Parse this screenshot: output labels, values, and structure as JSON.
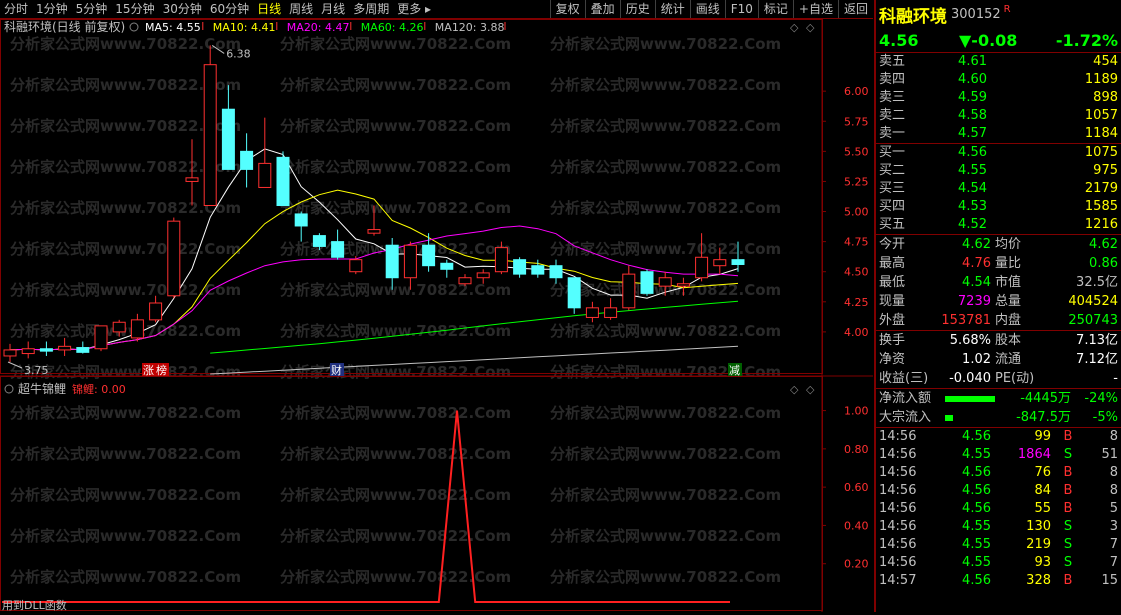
{
  "toolbar": {
    "periods": [
      "分时",
      "1分钟",
      "5分钟",
      "15分钟",
      "30分钟",
      "60分钟",
      "日线",
      "周线",
      "月线",
      "多周期",
      "更多"
    ],
    "active_index": 6,
    "right_buttons": [
      "复权",
      "叠加",
      "历史",
      "统计",
      "画线",
      "F10",
      "标记",
      "+自选",
      "返回"
    ]
  },
  "chart": {
    "title": "科融环境(日线 前复权)",
    "ma": [
      {
        "label": "MA5: 4.55",
        "color": "#ffffff"
      },
      {
        "label": "MA10: 4.41",
        "color": "#ffff00"
      },
      {
        "label": "MA20: 4.47",
        "color": "#ff00ff"
      },
      {
        "label": "MA60: 4.26",
        "color": "#00ff00"
      },
      {
        "label": "MA120: 3.88",
        "color": "#c0c0c0"
      }
    ],
    "high_label": "6.38",
    "low_label": "3.75",
    "price_ticks": [
      "6.00",
      "5.75",
      "5.50",
      "5.25",
      "5.00",
      "4.75",
      "4.50",
      "4.25",
      "4.00"
    ],
    "markers": [
      {
        "text": "涨",
        "bg": "#c00000"
      },
      {
        "text": "榜",
        "bg": "#c00000"
      },
      {
        "text": "财",
        "bg": "#203080"
      },
      {
        "text": "减",
        "bg": "#006000"
      }
    ],
    "watermark": "分析家公式网www.70822.Com"
  },
  "indicator": {
    "name": "超牛锦鲤",
    "series_label": "锦鲤: 0.00",
    "ticks": [
      "1.00",
      "0.80",
      "0.60",
      "0.40",
      "0.20"
    ],
    "footer": "用到DLL函数"
  },
  "chart_data": [
    {
      "type": "candlestick",
      "title": "科融环境(日线 前复权)",
      "ylim": [
        3.7,
        6.45
      ],
      "candles": [
        {
          "o": 3.8,
          "h": 3.9,
          "l": 3.75,
          "c": 3.85
        },
        {
          "o": 3.82,
          "h": 3.92,
          "l": 3.78,
          "c": 3.86
        },
        {
          "o": 3.86,
          "h": 3.92,
          "l": 3.8,
          "c": 3.84
        },
        {
          "o": 3.85,
          "h": 3.95,
          "l": 3.8,
          "c": 3.88
        },
        {
          "o": 3.87,
          "h": 3.92,
          "l": 3.82,
          "c": 3.83
        },
        {
          "o": 3.86,
          "h": 4.05,
          "l": 3.84,
          "c": 4.05
        },
        {
          "o": 4.0,
          "h": 4.1,
          "l": 3.96,
          "c": 4.08
        },
        {
          "o": 3.95,
          "h": 4.15,
          "l": 3.92,
          "c": 4.1
        },
        {
          "o": 4.1,
          "h": 4.3,
          "l": 4.08,
          "c": 4.24
        },
        {
          "o": 4.3,
          "h": 4.95,
          "l": 4.28,
          "c": 4.92
        },
        {
          "o": 5.25,
          "h": 5.6,
          "l": 5.05,
          "c": 5.28
        },
        {
          "o": 5.05,
          "h": 6.38,
          "l": 5.05,
          "c": 6.22
        },
        {
          "o": 5.85,
          "h": 6.05,
          "l": 5.4,
          "c": 5.35
        },
        {
          "o": 5.5,
          "h": 5.65,
          "l": 5.2,
          "c": 5.35
        },
        {
          "o": 5.2,
          "h": 5.78,
          "l": 5.2,
          "c": 5.4
        },
        {
          "o": 5.45,
          "h": 5.5,
          "l": 5.05,
          "c": 5.05
        },
        {
          "o": 4.98,
          "h": 5.0,
          "l": 4.75,
          "c": 4.88
        },
        {
          "o": 4.8,
          "h": 4.82,
          "l": 4.68,
          "c": 4.71
        },
        {
          "o": 4.75,
          "h": 4.85,
          "l": 4.6,
          "c": 4.62
        },
        {
          "o": 4.5,
          "h": 4.63,
          "l": 4.48,
          "c": 4.6
        },
        {
          "o": 4.82,
          "h": 5.05,
          "l": 4.8,
          "c": 4.85
        },
        {
          "o": 4.72,
          "h": 4.78,
          "l": 4.35,
          "c": 4.45
        },
        {
          "o": 4.45,
          "h": 4.75,
          "l": 4.35,
          "c": 4.72
        },
        {
          "o": 4.72,
          "h": 4.82,
          "l": 4.5,
          "c": 4.55
        },
        {
          "o": 4.57,
          "h": 4.6,
          "l": 4.45,
          "c": 4.52
        },
        {
          "o": 4.4,
          "h": 4.48,
          "l": 4.38,
          "c": 4.45
        },
        {
          "o": 4.45,
          "h": 4.52,
          "l": 4.4,
          "c": 4.49
        },
        {
          "o": 4.5,
          "h": 4.75,
          "l": 4.48,
          "c": 4.7
        },
        {
          "o": 4.6,
          "h": 4.62,
          "l": 4.45,
          "c": 4.48
        },
        {
          "o": 4.55,
          "h": 4.6,
          "l": 4.45,
          "c": 4.48
        },
        {
          "o": 4.55,
          "h": 4.6,
          "l": 4.4,
          "c": 4.45
        },
        {
          "o": 4.45,
          "h": 4.45,
          "l": 4.15,
          "c": 4.2
        },
        {
          "o": 4.12,
          "h": 4.25,
          "l": 4.08,
          "c": 4.2
        },
        {
          "o": 4.12,
          "h": 4.28,
          "l": 4.1,
          "c": 4.2
        },
        {
          "o": 4.2,
          "h": 4.55,
          "l": 4.18,
          "c": 4.48
        },
        {
          "o": 4.5,
          "h": 4.52,
          "l": 4.3,
          "c": 4.32
        },
        {
          "o": 4.38,
          "h": 4.5,
          "l": 4.3,
          "c": 4.45
        },
        {
          "o": 4.38,
          "h": 4.45,
          "l": 4.3,
          "c": 4.4
        },
        {
          "o": 4.45,
          "h": 4.82,
          "l": 4.42,
          "c": 4.62
        },
        {
          "o": 4.55,
          "h": 4.7,
          "l": 4.48,
          "c": 4.6
        },
        {
          "o": 4.6,
          "h": 4.75,
          "l": 4.5,
          "c": 4.56
        }
      ]
    },
    {
      "type": "line",
      "title": "超牛锦鲤",
      "ylim": [
        0,
        1.05
      ],
      "series": [
        {
          "name": "锦鲤",
          "values": [
            0,
            0,
            0,
            0,
            0,
            0,
            0,
            0,
            0,
            0,
            0,
            0,
            0,
            0,
            0,
            0,
            0,
            0,
            0,
            0,
            0,
            0,
            0,
            0,
            0,
            1,
            0,
            0,
            0,
            0,
            0,
            0,
            0,
            0,
            0,
            0,
            0,
            0,
            0,
            0,
            0
          ]
        }
      ]
    }
  ],
  "quote": {
    "name": "科融环境",
    "code": "300152",
    "flag": "R",
    "price": "4.56",
    "change": "▼-0.08",
    "pct": "-1.72%",
    "asks": [
      {
        "label": "卖五",
        "price": "4.61",
        "vol": "454",
        "color": "#00ff00"
      },
      {
        "label": "卖四",
        "price": "4.60",
        "vol": "1189",
        "color": "#00ff00"
      },
      {
        "label": "卖三",
        "price": "4.59",
        "vol": "898",
        "color": "#00ff00"
      },
      {
        "label": "卖二",
        "price": "4.58",
        "vol": "1057",
        "color": "#00ff00"
      },
      {
        "label": "卖一",
        "price": "4.57",
        "vol": "1184",
        "color": "#00ff00"
      }
    ],
    "bids": [
      {
        "label": "买一",
        "price": "4.56",
        "vol": "1075",
        "color": "#00ff00"
      },
      {
        "label": "买二",
        "price": "4.55",
        "vol": "975",
        "color": "#00ff00"
      },
      {
        "label": "买三",
        "price": "4.54",
        "vol": "2179",
        "color": "#00ff00"
      },
      {
        "label": "买四",
        "price": "4.53",
        "vol": "1585",
        "color": "#00ff00"
      },
      {
        "label": "买五",
        "price": "4.52",
        "vol": "1216",
        "color": "#00ff00"
      }
    ],
    "stats": [
      {
        "l1": "今开",
        "v1": "4.62",
        "c1": "#00ff00",
        "l2": "均价",
        "v2": "4.62",
        "c2": "#00ff00"
      },
      {
        "l1": "最高",
        "v1": "4.76",
        "c1": "#ff3030",
        "l2": "量比",
        "v2": "0.86",
        "c2": "#00ff00"
      },
      {
        "l1": "最低",
        "v1": "4.54",
        "c1": "#00ff00",
        "l2": "市值",
        "v2": "32.5亿",
        "c2": "#c0c0c0"
      },
      {
        "l1": "现量",
        "v1": "7239",
        "c1": "#ff00ff",
        "l2": "总量",
        "v2": "404524",
        "c2": "#ffff00"
      },
      {
        "l1": "外盘",
        "v1": "153781",
        "c1": "#ff3030",
        "l2": "内盘",
        "v2": "250743",
        "c2": "#00ff00"
      }
    ],
    "fund": [
      {
        "l1": "换手",
        "v1": "5.68%",
        "l2": "股本",
        "v2": "7.13亿"
      },
      {
        "l1": "净资",
        "v1": "1.02",
        "l2": "流通",
        "v2": "7.12亿"
      },
      {
        "l1": "收益(三)",
        "v1": "-0.040",
        "l2": "PE(动)",
        "v2": "-"
      }
    ],
    "flows": [
      {
        "label": "净流入额",
        "amount": "-4445万",
        "pct": "-24%",
        "bar": 0.9
      },
      {
        "label": "大宗流入",
        "amount": "-847.5万",
        "pct": "-5%",
        "bar": 0.15
      }
    ],
    "ticks": [
      {
        "t": "14:56",
        "p": "4.56",
        "v": "99",
        "bs": "B",
        "n": "8",
        "vc": "#ffff00"
      },
      {
        "t": "14:56",
        "p": "4.55",
        "v": "1864",
        "bs": "S",
        "n": "51",
        "vc": "#ff00ff"
      },
      {
        "t": "14:56",
        "p": "4.56",
        "v": "76",
        "bs": "B",
        "n": "8",
        "vc": "#ffff00"
      },
      {
        "t": "14:56",
        "p": "4.56",
        "v": "84",
        "bs": "B",
        "n": "8",
        "vc": "#ffff00"
      },
      {
        "t": "14:56",
        "p": "4.56",
        "v": "55",
        "bs": "B",
        "n": "5",
        "vc": "#ffff00"
      },
      {
        "t": "14:56",
        "p": "4.55",
        "v": "130",
        "bs": "S",
        "n": "3",
        "vc": "#ffff00"
      },
      {
        "t": "14:56",
        "p": "4.55",
        "v": "219",
        "bs": "S",
        "n": "7",
        "vc": "#ffff00"
      },
      {
        "t": "14:56",
        "p": "4.55",
        "v": "93",
        "bs": "S",
        "n": "7",
        "vc": "#ffff00"
      },
      {
        "t": "14:57",
        "p": "4.56",
        "v": "328",
        "bs": "B",
        "n": "15",
        "vc": "#ffff00"
      }
    ]
  }
}
